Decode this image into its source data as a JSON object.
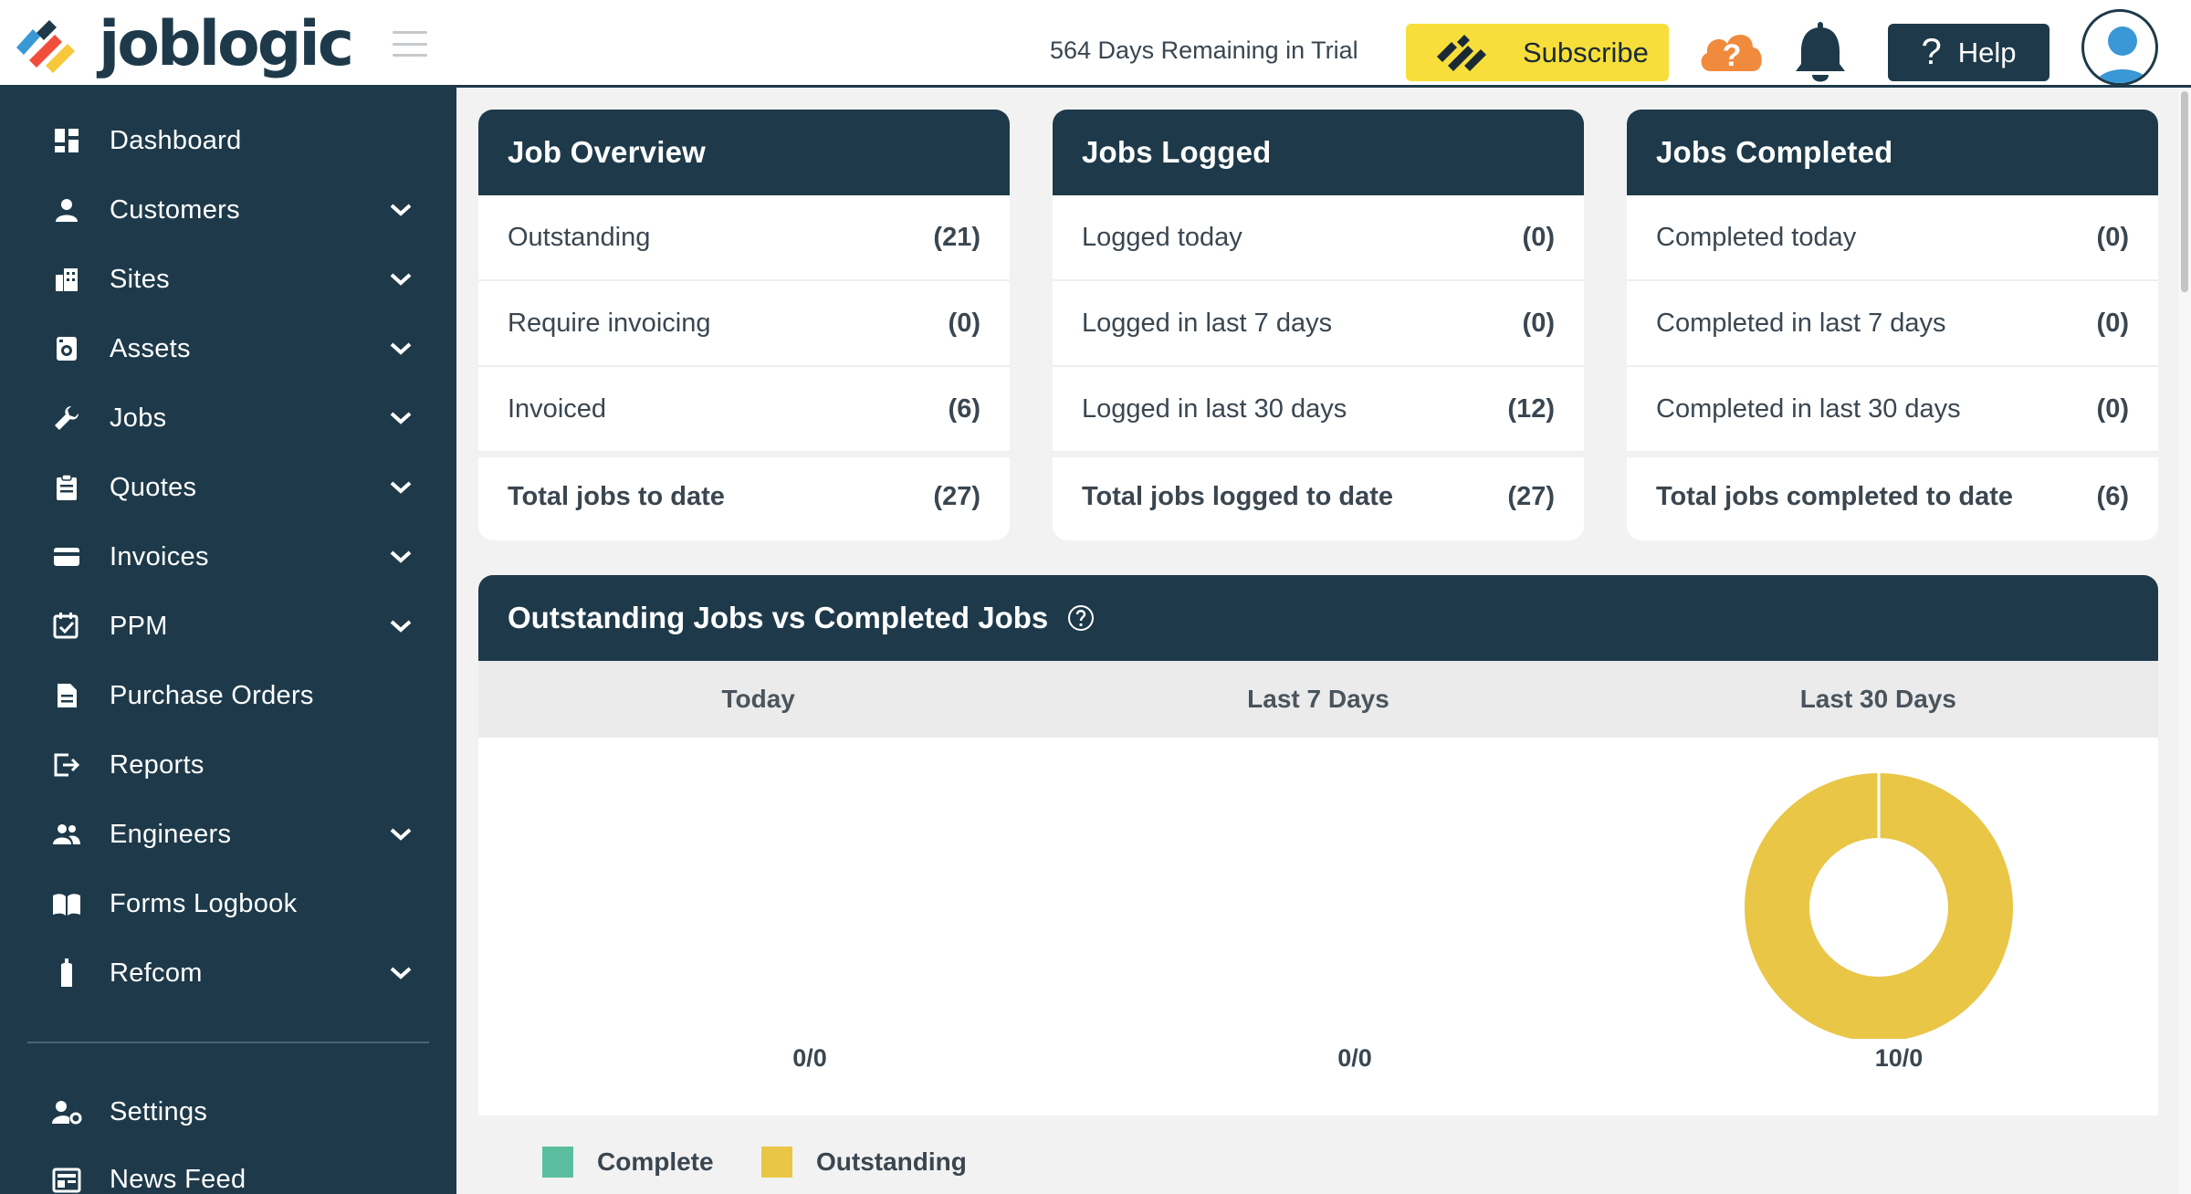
{
  "header": {
    "brand": "joblogic",
    "trial_text": "564 Days Remaining in Trial",
    "subscribe_label": "Subscribe",
    "help_label": "Help",
    "help_glyph": "?",
    "cloud_glyph": "?",
    "brand_color": "#1e3a4a",
    "subscribe_color": "#f7de3a",
    "alert_color": "#f08a3c"
  },
  "sidebar": {
    "items": [
      {
        "label": "Dashboard",
        "icon": "dashboard-icon",
        "has_submenu": false
      },
      {
        "label": "Customers",
        "icon": "person-icon",
        "has_submenu": true
      },
      {
        "label": "Sites",
        "icon": "building-icon",
        "has_submenu": true
      },
      {
        "label": "Assets",
        "icon": "asset-icon",
        "has_submenu": true
      },
      {
        "label": "Jobs",
        "icon": "wrench-icon",
        "has_submenu": true
      },
      {
        "label": "Quotes",
        "icon": "clipboard-icon",
        "has_submenu": true
      },
      {
        "label": "Invoices",
        "icon": "card-icon",
        "has_submenu": true
      },
      {
        "label": "PPM",
        "icon": "calendar-check-icon",
        "has_submenu": true
      },
      {
        "label": "Purchase Orders",
        "icon": "document-icon",
        "has_submenu": false
      },
      {
        "label": "Reports",
        "icon": "export-icon",
        "has_submenu": false
      },
      {
        "label": "Engineers",
        "icon": "people-icon",
        "has_submenu": true
      },
      {
        "label": "Forms Logbook",
        "icon": "book-icon",
        "has_submenu": false
      },
      {
        "label": "Refcom",
        "icon": "cylinder-icon",
        "has_submenu": true
      }
    ],
    "bottom_items": [
      {
        "label": "Settings",
        "icon": "user-cog-icon"
      },
      {
        "label": "News Feed",
        "icon": "newspaper-icon"
      }
    ]
  },
  "cards": [
    {
      "title": "Job Overview",
      "rows": [
        {
          "label": "Outstanding",
          "count": "(21)"
        },
        {
          "label": "Require invoicing",
          "count": "(0)"
        },
        {
          "label": "Invoiced",
          "count": "(6)"
        }
      ],
      "total": {
        "label": "Total jobs to date",
        "count": "(27)"
      }
    },
    {
      "title": "Jobs Logged",
      "rows": [
        {
          "label": "Logged today",
          "count": "(0)"
        },
        {
          "label": "Logged in last 7 days",
          "count": "(0)"
        },
        {
          "label": "Logged in last 30 days",
          "count": "(12)"
        }
      ],
      "total": {
        "label": "Total jobs logged to date",
        "count": "(27)"
      }
    },
    {
      "title": "Jobs Completed",
      "rows": [
        {
          "label": "Completed today",
          "count": "(0)"
        },
        {
          "label": "Completed in last 7 days",
          "count": "(0)"
        },
        {
          "label": "Completed in last 30 days",
          "count": "(0)"
        }
      ],
      "total": {
        "label": "Total jobs completed to date",
        "count": "(6)"
      }
    }
  ],
  "chart_panel": {
    "title": "Outstanding Jobs vs Completed Jobs",
    "periods": [
      "Today",
      "Last 7 Days",
      "Last 30 Days"
    ],
    "donut_labels": [
      "0/0",
      "0/0",
      "10/0"
    ],
    "legend": [
      {
        "name": "Complete",
        "color": "#5bbf9f"
      },
      {
        "name": "Outstanding",
        "color": "#e9c646"
      }
    ]
  },
  "chart_data": {
    "type": "pie",
    "style": "donut",
    "categories": [
      "Today",
      "Last 7 Days",
      "Last 30 Days"
    ],
    "series": [
      {
        "name": "Complete",
        "values": [
          0,
          0,
          0
        ]
      },
      {
        "name": "Outstanding",
        "values": [
          0,
          0,
          10
        ]
      }
    ],
    "title": "Outstanding Jobs vs Completed Jobs",
    "legend": "bottom-left"
  }
}
